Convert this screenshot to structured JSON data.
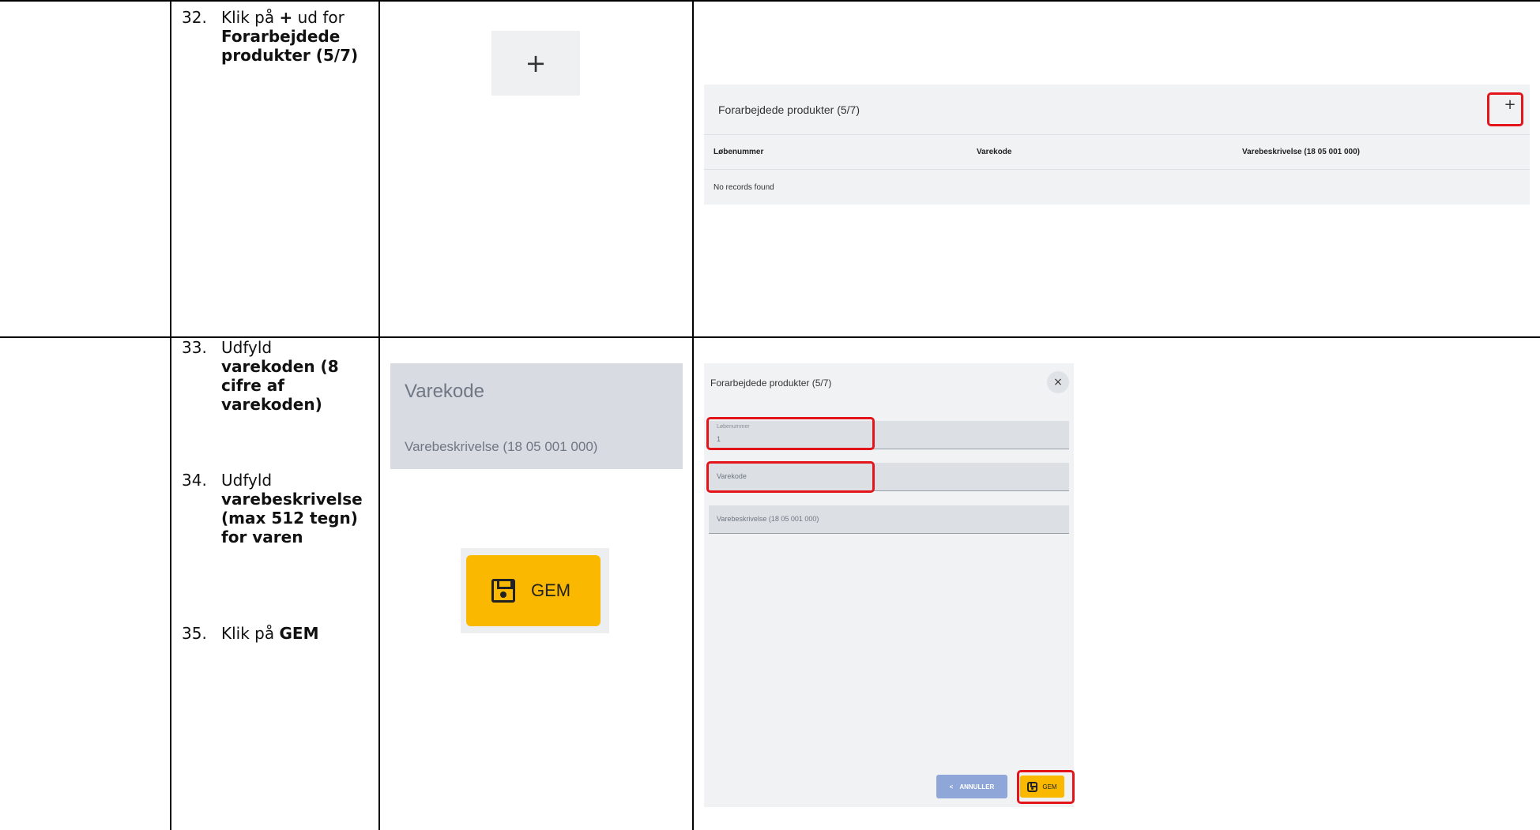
{
  "rows": [
    {
      "steps": [
        {
          "num": "32.",
          "text": "Klik på ",
          "bold": "+",
          "text2": " ud for",
          "bold2": "Forarbejdede produkter (5/7)"
        }
      ],
      "crop_plus": "+",
      "panel": {
        "title": "Forarbejdede produkter (5/7)",
        "add_label": "+",
        "columns": [
          "Løbenummer",
          "Varekode",
          "Varebeskrivelse (18 05 001 000)"
        ],
        "empty_text": "No records found"
      }
    },
    {
      "steps": [
        {
          "num": "33.",
          "text": "Udfyld",
          "bold": "varekoden (8 cifre af varekoden)"
        },
        {
          "num": "34.",
          "text": "Udfyld",
          "bold": "varebeskrivelse (max 512 tegn) for varen"
        },
        {
          "num": "35.",
          "text": "Klik på ",
          "bold": "GEM"
        }
      ],
      "crop_fields": {
        "field1": "Varekode",
        "field2": "Varebeskrivelse (18 05 001 000)"
      },
      "crop_gem": "GEM",
      "dialog": {
        "title": "Forarbejdede produkter (5/7)",
        "close": "×",
        "lobenummer_label": "Løbenummer",
        "lobenummer_value": "1",
        "varekode_placeholder": "Varekode",
        "varebeskrivelse_placeholder": "Varebeskrivelse (18 05 001 000)",
        "annuller": "ANNULLER",
        "annuller_icon": "<",
        "gem": "GEM"
      }
    }
  ],
  "colors": {
    "highlight": "#e3151a",
    "gem_yellow": "#fbb800",
    "annuller_blue": "#8ea6d8"
  }
}
